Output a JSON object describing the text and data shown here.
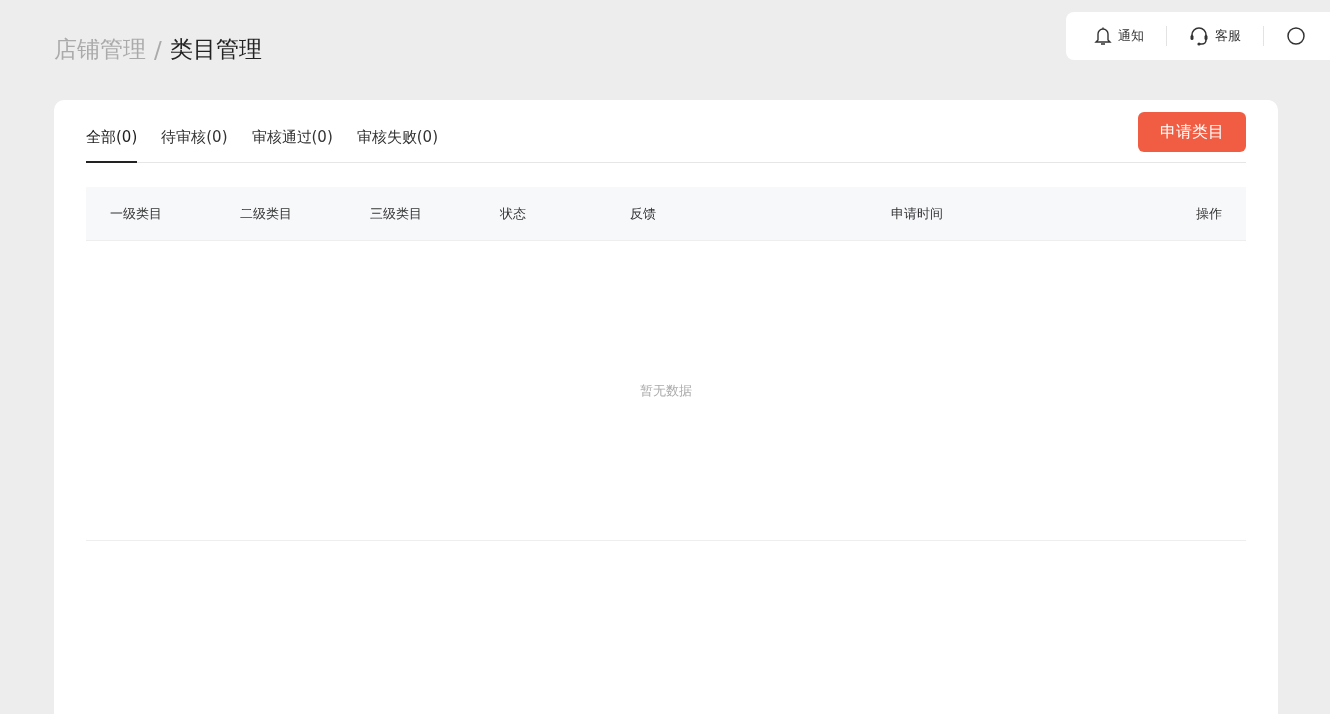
{
  "breadcrumb": {
    "parent": "店铺管理",
    "separator": "/",
    "current": "类目管理"
  },
  "topbar": {
    "items": [
      {
        "kind": "bell",
        "label": "通知"
      },
      {
        "kind": "headset",
        "label": "客服"
      },
      {
        "kind": "partial"
      }
    ]
  },
  "tabs": [
    {
      "label": "全部(0)",
      "selected": true
    },
    {
      "label": "待审核(0)",
      "selected": false
    },
    {
      "label": "审核通过(0)",
      "selected": false
    },
    {
      "label": "审核失败(0)",
      "selected": false
    }
  ],
  "apply_button": "申请类目",
  "table": {
    "columns": [
      "一级类目",
      "二级类目",
      "三级类目",
      "状态",
      "反馈",
      "申请时间",
      "操作"
    ],
    "empty_text": "暂无数据"
  }
}
